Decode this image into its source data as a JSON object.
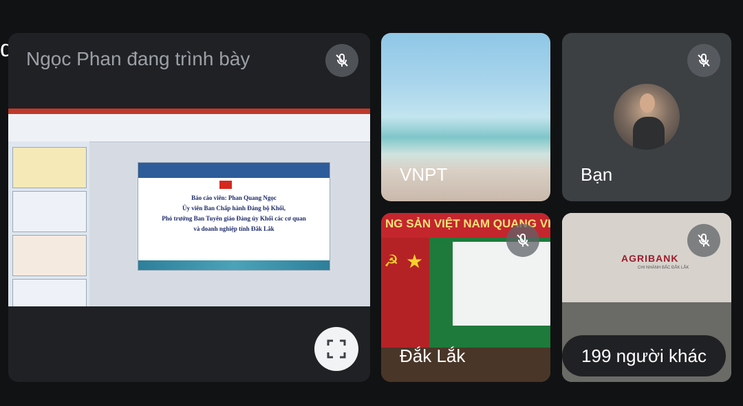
{
  "meeting": {
    "code": "q-mjcv-cdc",
    "presenting_label": "Ngọc Phan đang trình bày"
  },
  "presentation": {
    "slide_lines": [
      "Báo cáo viên: Phan Quang Ngọc",
      "Ủy viên Ban Chấp hành Đảng bộ Khối,",
      "Phó trưởng Ban Tuyên giáo Đảng ủy Khối các cơ quan",
      "và doanh nghiệp tỉnh Đắk Lắk"
    ]
  },
  "participants": [
    {
      "name": "VNPT",
      "muted": false
    },
    {
      "name": "Bạn",
      "muted": true
    },
    {
      "name": "Đắk Lắk",
      "muted": true,
      "banner": "NG SẢN VIỆT NAM QUANG VINH MU"
    },
    {
      "name": "",
      "muted": true,
      "logo": "AGRIBANK",
      "logo_sub": "CHI NHÁNH BẮC ĐẮK LẮK"
    }
  ],
  "others_label": "199 người khác",
  "icons": {
    "mic_off": "mic-off-icon",
    "fullscreen": "fullscreen-icon",
    "chevron": "chevron-right-icon"
  },
  "colors": {
    "background": "#111214",
    "tile": "#202124",
    "muted_button": "#5f6368"
  }
}
